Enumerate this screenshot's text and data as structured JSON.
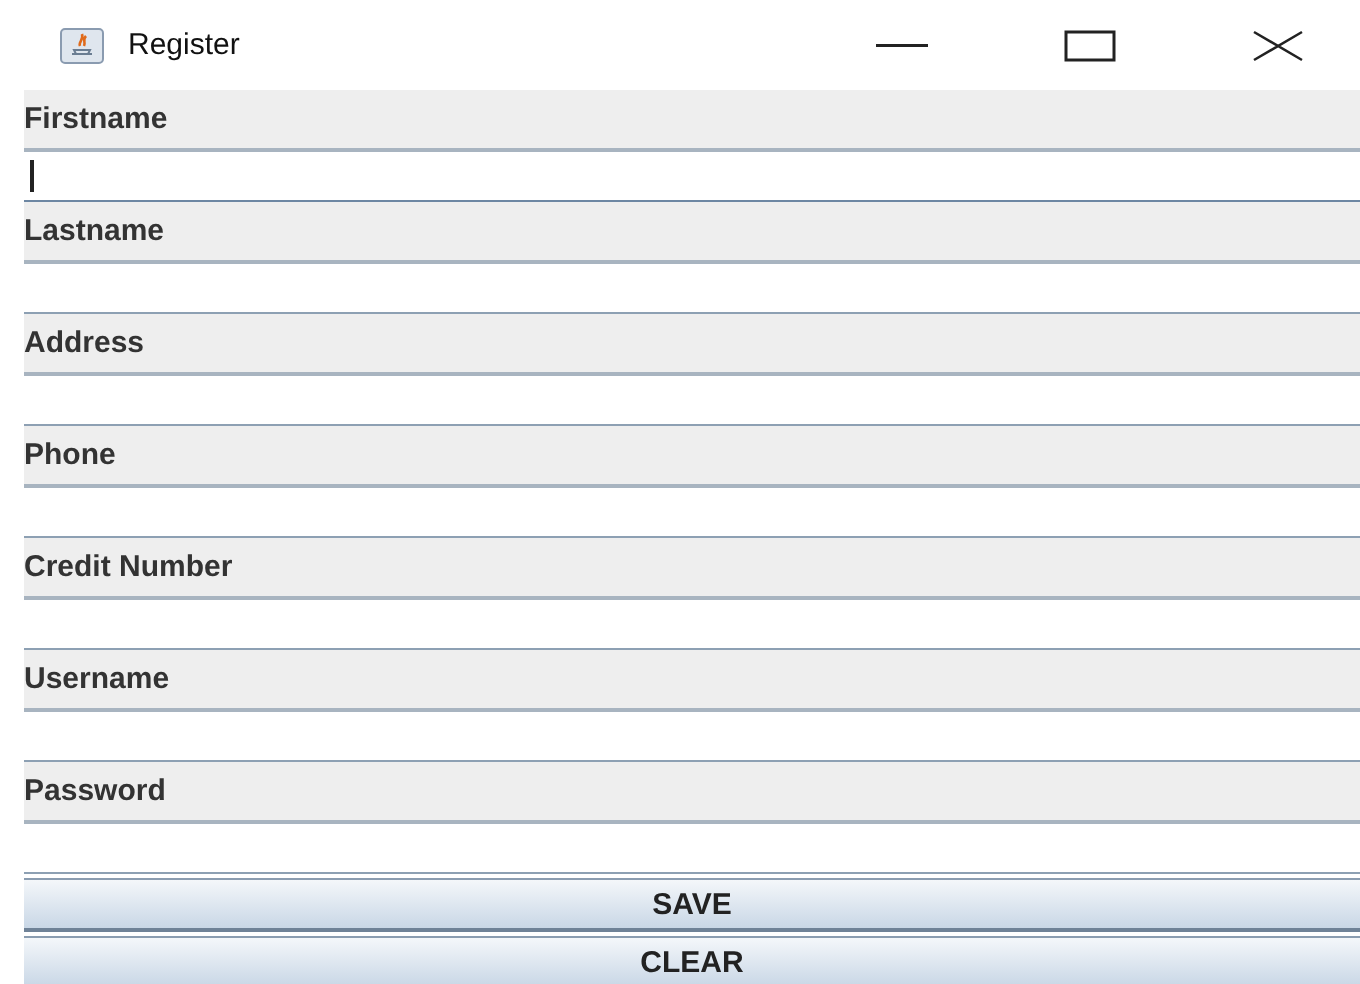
{
  "window": {
    "title": "Register"
  },
  "fields": [
    {
      "label": "Firstname",
      "focused": true
    },
    {
      "label": "Lastname",
      "focused": false
    },
    {
      "label": "Address",
      "focused": false
    },
    {
      "label": "Phone",
      "focused": false
    },
    {
      "label": "Credit Number",
      "focused": false
    },
    {
      "label": "Username",
      "focused": false
    },
    {
      "label": "Password",
      "focused": false
    }
  ],
  "buttons": [
    "SAVE",
    "CLEAR"
  ]
}
